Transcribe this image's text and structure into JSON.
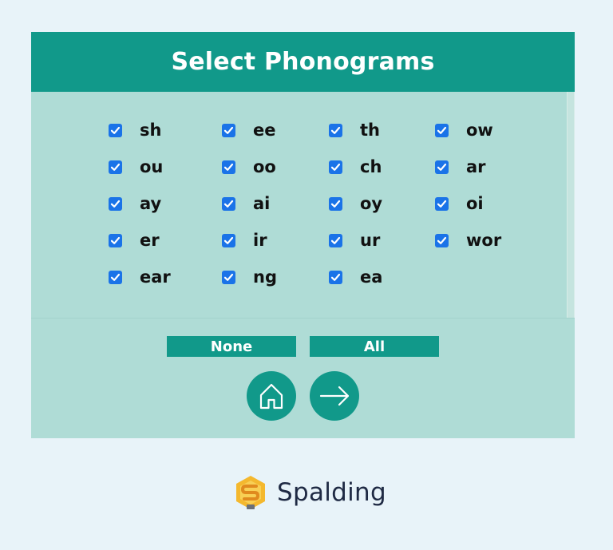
{
  "header": {
    "title": "Select Phonograms"
  },
  "phonograms": [
    {
      "label": "sh",
      "checked": true
    },
    {
      "label": "ee",
      "checked": true
    },
    {
      "label": "th",
      "checked": true
    },
    {
      "label": "ow",
      "checked": true
    },
    {
      "label": "ou",
      "checked": true
    },
    {
      "label": "oo",
      "checked": true
    },
    {
      "label": "ch",
      "checked": true
    },
    {
      "label": "ar",
      "checked": true
    },
    {
      "label": "ay",
      "checked": true
    },
    {
      "label": "ai",
      "checked": true
    },
    {
      "label": "oy",
      "checked": true
    },
    {
      "label": "oi",
      "checked": true
    },
    {
      "label": "er",
      "checked": true
    },
    {
      "label": "ir",
      "checked": true
    },
    {
      "label": "ur",
      "checked": true
    },
    {
      "label": "wor",
      "checked": true
    },
    {
      "label": "ear",
      "checked": true
    },
    {
      "label": "ng",
      "checked": true
    },
    {
      "label": "ea",
      "checked": true
    }
  ],
  "controls": {
    "none_label": "None",
    "all_label": "All",
    "home_icon": "home-icon",
    "next_icon": "arrow-right-icon"
  },
  "brand": {
    "name": "Spalding",
    "logo_icon": "spalding-logo-icon"
  },
  "colors": {
    "background": "#e8f3f9",
    "panel": "#afdcd6",
    "accent": "#11998a",
    "checkbox": "#1a73e8",
    "text": "#111111"
  }
}
